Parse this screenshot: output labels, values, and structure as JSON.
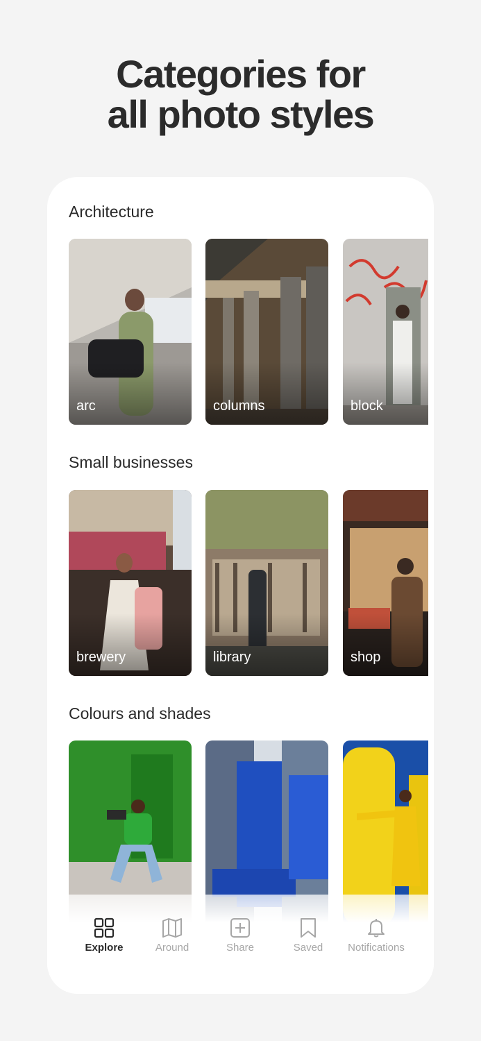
{
  "headline": {
    "line1": "Categories for",
    "line2": "all photo styles"
  },
  "sections": [
    {
      "title": "Architecture",
      "tiles": [
        {
          "label": "arc"
        },
        {
          "label": "columns"
        },
        {
          "label": "block"
        }
      ]
    },
    {
      "title": "Small businesses",
      "tiles": [
        {
          "label": "brewery"
        },
        {
          "label": "library"
        },
        {
          "label": "shop"
        }
      ]
    },
    {
      "title": "Colours and shades",
      "tiles": [
        {
          "label": ""
        },
        {
          "label": ""
        },
        {
          "label": ""
        }
      ]
    }
  ],
  "tabs": [
    {
      "label": "Explore",
      "icon": "grid-icon",
      "active": true
    },
    {
      "label": "Around",
      "icon": "map-icon",
      "active": false
    },
    {
      "label": "Share",
      "icon": "plus-square-icon",
      "active": false
    },
    {
      "label": "Saved",
      "icon": "bookmark-icon",
      "active": false
    },
    {
      "label": "Notifications",
      "icon": "bell-icon",
      "active": false
    }
  ],
  "colors": {
    "background": "#f4f4f4",
    "card": "#ffffff",
    "text": "#2a2a2a",
    "inactive_tab": "#a6a6a6"
  }
}
